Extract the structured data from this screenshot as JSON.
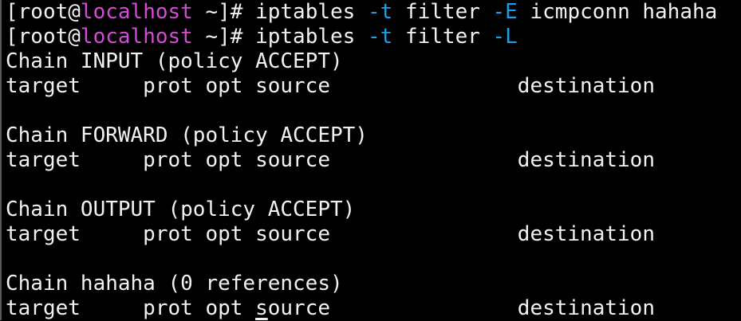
{
  "colors": {
    "background": "#000000",
    "text": "#f2f2f2",
    "hostname": "#d44bd6",
    "option_flag": "#1ea0e6"
  },
  "commands": [
    {
      "prompt_user_prefix": "[root@",
      "prompt_host": "localhost",
      "prompt_suffix": " ~]# ",
      "cmd_head": "iptables ",
      "flag1": "-t",
      "cmd_mid": " filter ",
      "flag2": "-E",
      "cmd_tail": " icmpconn hahaha"
    },
    {
      "prompt_user_prefix": "[root@",
      "prompt_host": "localhost",
      "prompt_suffix": " ~]# ",
      "cmd_head": "iptables ",
      "flag1": "-t",
      "cmd_mid": " filter ",
      "flag2": "-L",
      "cmd_tail": ""
    }
  ],
  "output": {
    "chain_input": "Chain INPUT (policy ACCEPT)",
    "chain_forward": "Chain FORWARD (policy ACCEPT)",
    "chain_output": "Chain OUTPUT (policy ACCEPT)",
    "chain_custom": "Chain hahaha (0 references)",
    "header_row": "target     prot opt source               destination",
    "header_cursor_prefix": "target     prot opt ",
    "header_cursor_char": "s",
    "header_cursor_suffix": "ource               destination"
  }
}
